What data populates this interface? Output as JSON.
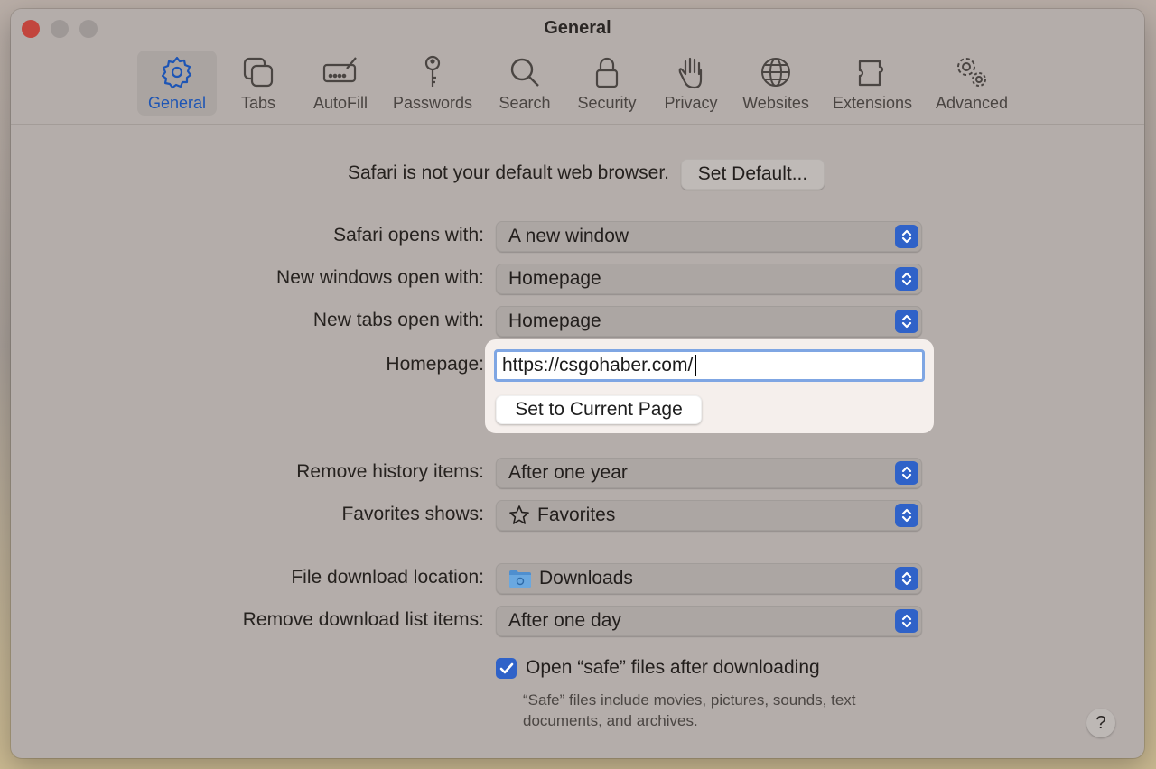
{
  "window": {
    "title": "General"
  },
  "toolbar": {
    "items": [
      {
        "label": "General",
        "icon": "gear-icon",
        "active": true
      },
      {
        "label": "Tabs",
        "icon": "tabs-icon"
      },
      {
        "label": "AutoFill",
        "icon": "autofill-icon"
      },
      {
        "label": "Passwords",
        "icon": "key-icon"
      },
      {
        "label": "Search",
        "icon": "magnifier-icon"
      },
      {
        "label": "Security",
        "icon": "lock-icon"
      },
      {
        "label": "Privacy",
        "icon": "hand-icon"
      },
      {
        "label": "Websites",
        "icon": "globe-icon"
      },
      {
        "label": "Extensions",
        "icon": "puzzle-icon"
      },
      {
        "label": "Advanced",
        "icon": "gears-icon"
      }
    ]
  },
  "default_browser": {
    "text": "Safari is not your default web browser.",
    "button": "Set Default..."
  },
  "settings": {
    "safari_opens": {
      "label": "Safari opens with:",
      "value": "A new window"
    },
    "new_windows": {
      "label": "New windows open with:",
      "value": "Homepage"
    },
    "new_tabs": {
      "label": "New tabs open with:",
      "value": "Homepage"
    },
    "homepage": {
      "label": "Homepage:",
      "value": "https://csgohaber.com/",
      "button": "Set to Current Page"
    },
    "remove_history": {
      "label": "Remove history items:",
      "value": "After one year"
    },
    "favorites_shows": {
      "label": "Favorites shows:",
      "value": "Favorites",
      "icon": "star-icon"
    },
    "download_location": {
      "label": "File download location:",
      "value": "Downloads",
      "icon": "folder-icon"
    },
    "remove_downloads": {
      "label": "Remove download list items:",
      "value": "After one day"
    }
  },
  "open_safe": {
    "label": "Open “safe” files after downloading",
    "checked": true,
    "note": "“Safe” files include movies, pictures, sounds, text documents, and archives."
  },
  "help": {
    "label": "?"
  },
  "colors": {
    "accent": "#2f62c8",
    "active_label": "#1d55b5",
    "close": "#c2453d"
  }
}
